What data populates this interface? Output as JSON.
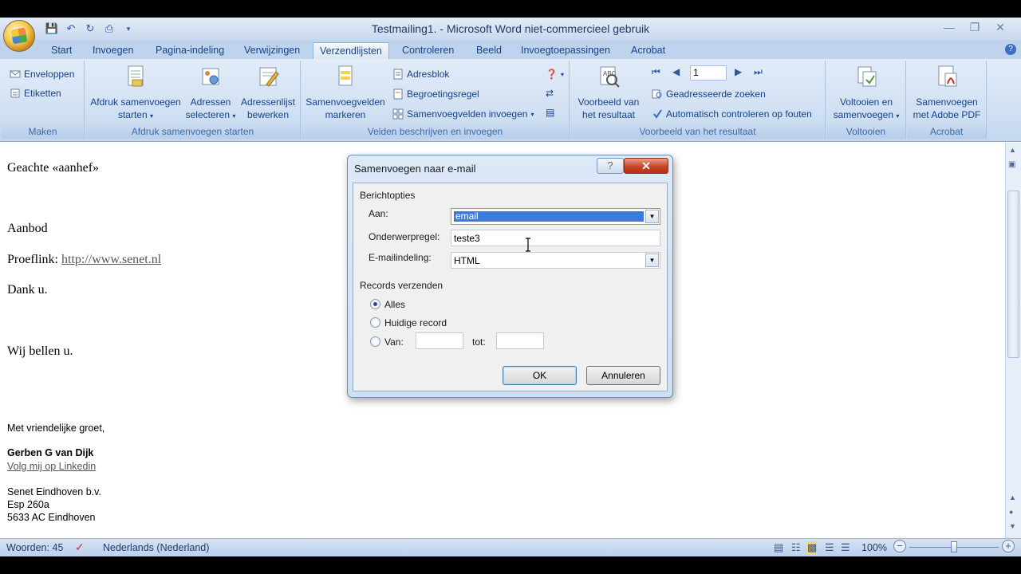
{
  "window": {
    "title": "Testmailing1. - Microsoft Word niet-commercieel gebruik"
  },
  "tabs": [
    "Start",
    "Invoegen",
    "Pagina-indeling",
    "Verwijzingen",
    "Verzendlijsten",
    "Controleren",
    "Beeld",
    "Invoegtoepassingen",
    "Acrobat"
  ],
  "active_tab": "Verzendlijsten",
  "ribbon": {
    "maken": {
      "label": "Maken",
      "enveloppen": "Enveloppen",
      "etiketten": "Etiketten"
    },
    "afdruk": {
      "label": "Afdruk samenvoegen starten",
      "start_line1": "Afdruk samenvoegen",
      "start_line2": "starten",
      "adressen_line1": "Adressen",
      "adressen_line2": "selecteren",
      "lijst_line1": "Adressenlijst",
      "lijst_line2": "bewerken"
    },
    "velden": {
      "label": "Velden beschrijven en invoegen",
      "markeren_line1": "Samenvoegvelden",
      "markeren_line2": "markeren",
      "adresblok": "Adresblok",
      "begroetingsregel": "Begroetingsregel",
      "invoegen": "Samenvoegvelden invoegen"
    },
    "voorbeeld": {
      "label": "Voorbeeld van het resultaat",
      "btn_line1": "Voorbeeld van",
      "btn_line2": "het resultaat",
      "record_value": "1",
      "zoeken": "Geadresseerde zoeken",
      "controleren": "Automatisch controleren op fouten"
    },
    "voltooien": {
      "label": "Voltooien",
      "btn_line1": "Voltooien en",
      "btn_line2": "samenvoegen"
    },
    "acrobat": {
      "label": "Acrobat",
      "btn_line1": "Samenvoegen",
      "btn_line2": "met Adobe PDF"
    }
  },
  "document": {
    "greeting": "Geachte «aanhef»",
    "aanbod": "Aanbod",
    "proeflink_label": "Proeflink: ",
    "proeflink_url": "http://www.senet.nl",
    "dank": "Dank u.",
    "bellen": "Wij bellen u.",
    "groet": "Met vriendelijke groet,",
    "naam": "Gerben G van Dijk",
    "linkedin": "Volg mij op Linkedin",
    "bedrijf": "Senet Eindhoven b.v.",
    "adres1": "Esp 260a",
    "adres2": "5633 AC Eindhoven"
  },
  "status": {
    "woorden": "Woorden: 45",
    "taal": "Nederlands (Nederland)",
    "zoom": "100%"
  },
  "dialog": {
    "title": "Samenvoegen naar e-mail",
    "section_berichtopties": "Berichtopties",
    "aan_label": "Aan:",
    "aan_value": "email",
    "onderwerp_label": "Onderwerpregel:",
    "onderwerp_value": "teste3",
    "indeling_label": "E-mailindeling:",
    "indeling_value": "HTML",
    "section_records": "Records verzenden",
    "opt_alles": "Alles",
    "opt_huidig": "Huidige record",
    "opt_van": "Van:",
    "tot_label": "tot:",
    "van_value": "",
    "tot_value": "",
    "ok": "OK",
    "annuleren": "Annuleren",
    "help": "?",
    "close": "✕"
  }
}
